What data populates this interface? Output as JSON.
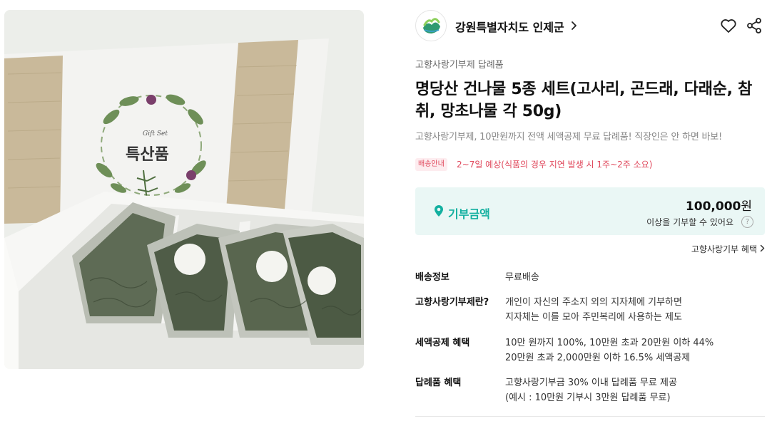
{
  "seller": {
    "name": "강원특별자치도 인제군"
  },
  "product": {
    "category": "고향사랑기부제 답례품",
    "title_line1": "명당산 건나물 5종 세트(고사리, 곤드래, 다래순, 참",
    "title_line2": "취, 망초나물 각 50g)",
    "subtitle": "고향사랑기부제, 10만원까지 전액 세액공제 무료 답례품! 직장인은 안 하면 바보!",
    "image": {
      "box_label_small": "Gift Set",
      "box_label_main": "특산품"
    }
  },
  "shipping_notice": {
    "badge": "배송안내",
    "text": "2~7일 예상(식품의 경우 지연 발생 시 1주~2주 소요)"
  },
  "donation": {
    "label": "기부금액",
    "amount": "100,000",
    "unit": "원",
    "note": "이상을 기부할 수 있어요",
    "help": "?"
  },
  "benefit_link": "고향사랑기부 혜택",
  "info": [
    {
      "label": "배송정보",
      "lines": [
        "무료배송"
      ]
    },
    {
      "label": "고향사랑기부제란?",
      "lines": [
        "개인이 자신의 주소지 외의 지자체에 기부하면",
        "지자체는 이를 모아 주민복리에 사용하는 제도"
      ]
    },
    {
      "label": "세액공제 혜택",
      "lines": [
        "10만 원까지 100%, 10만원 초과 20만원 이하 44%",
        "20만원 초과 2,000만원 이하 16.5% 세액공제"
      ]
    },
    {
      "label": "답례품 혜택",
      "lines": [
        "고향사랑기부금 30% 이내 답례품 무료 제공",
        "(예시 : 10만원 기부시 3만원 답례품 무료)"
      ]
    }
  ],
  "colors": {
    "accent": "#14b0a0",
    "donate_bg": "#eaf7f5",
    "notice": "#e0485c"
  },
  "icons": [
    "heart-icon",
    "share-icon",
    "chevron-right-icon",
    "location-pin-icon",
    "help-icon"
  ]
}
